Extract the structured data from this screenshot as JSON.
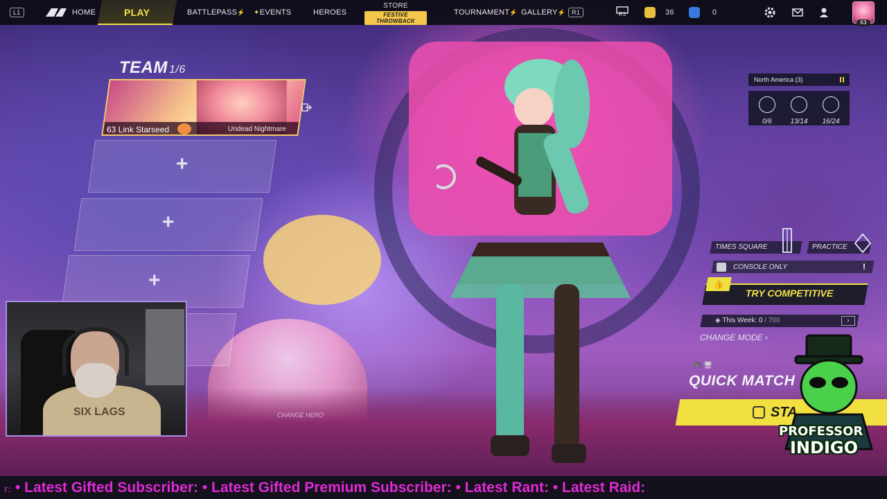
{
  "nav": {
    "l1": "L1",
    "r1": "R1",
    "home": "HOME",
    "play": "PLAY",
    "battlepass": "BATTLEPASS",
    "events": "EVENTS",
    "heroes": "HEROES",
    "store": "STORE",
    "store_promo": "FESTIVE THROWBACK",
    "tournament": "TOURNAMENT",
    "gallery": "GALLERY",
    "r3": "R3",
    "currency_1": "36",
    "currency_2": "0",
    "player_level": "63",
    "new_flag": "⚡"
  },
  "team": {
    "title": "TEAM",
    "count": "1/6",
    "member": {
      "level_name": "63 Link Starseed",
      "skin": "Undead Nightmare"
    },
    "empty_slot_symbol": "+",
    "change_hero": "CHANGE HERO"
  },
  "region": {
    "label": "North America (3)"
  },
  "stats": [
    {
      "icon": "clipboard-icon",
      "value": "0/6"
    },
    {
      "icon": "crossed-swords-icon",
      "value": "13/14"
    },
    {
      "icon": "trophy-icon",
      "value": "16/24"
    }
  ],
  "modes": {
    "times_square": "TIMES SQUARE",
    "practice": "PRACTICE",
    "console_only": "CONSOLE ONLY",
    "warn": "!",
    "try_competitive": "TRY COMPETITIVE",
    "this_week_label": "This Week:",
    "this_week_value": "0",
    "this_week_total": "/ 700",
    "change_mode": "CHANGE MODE",
    "quick_match": "QUICK MATCH",
    "start": "STA"
  },
  "logo": {
    "line1": "PROFESSOR",
    "line2": "INDIGO"
  },
  "webcam": {
    "hoodie_text": "SIX LAGS"
  },
  "ticker": {
    "lead": "r:",
    "text": " • Latest Gifted Subscriber: • Latest Gifted Premium Subscriber: • Latest Rant: • Latest Raid:"
  },
  "colors": {
    "accent_yellow": "#f2e040",
    "ticker_magenta": "#e02ad6",
    "nav_bg": "#0c0c14"
  }
}
